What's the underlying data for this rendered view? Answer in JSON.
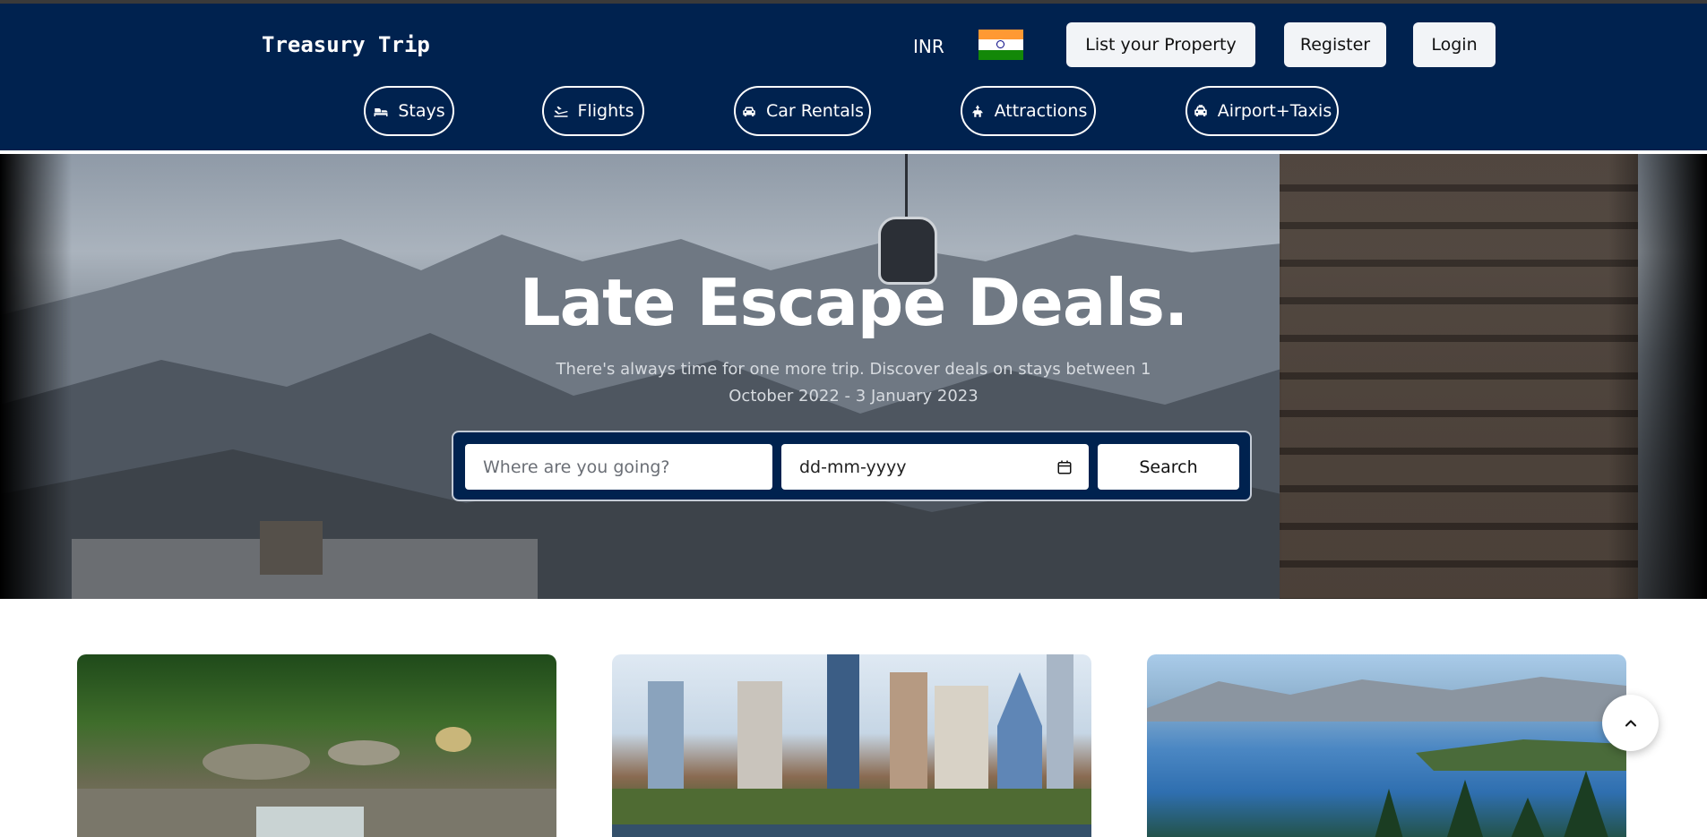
{
  "header": {
    "brand": "Treasury Trip",
    "currency": "INR",
    "flag_icon": "india-flag-icon",
    "list_property": "List your Property",
    "register": "Register",
    "login": "Login",
    "nav": [
      {
        "label": "Stays",
        "icon": "bed-icon"
      },
      {
        "label": "Flights",
        "icon": "plane-icon"
      },
      {
        "label": "Car Rentals",
        "icon": "car-icon"
      },
      {
        "label": "Attractions",
        "icon": "attractions-icon"
      },
      {
        "label": "Airport+Taxis",
        "icon": "taxi-icon"
      }
    ]
  },
  "hero": {
    "title": "Late Escape Deals.",
    "subtitle": "There's always time for one more trip. Discover deals on stays between 1 October 2022 - 3 January 2023",
    "search": {
      "destination_placeholder": "Where are you going?",
      "date_placeholder": "dd-mm-yyyy",
      "button": "Search"
    }
  },
  "colors": {
    "header_bg": "#00224f",
    "search_bar_bg": "#00224f",
    "button_bg": "#f2f4f7"
  }
}
